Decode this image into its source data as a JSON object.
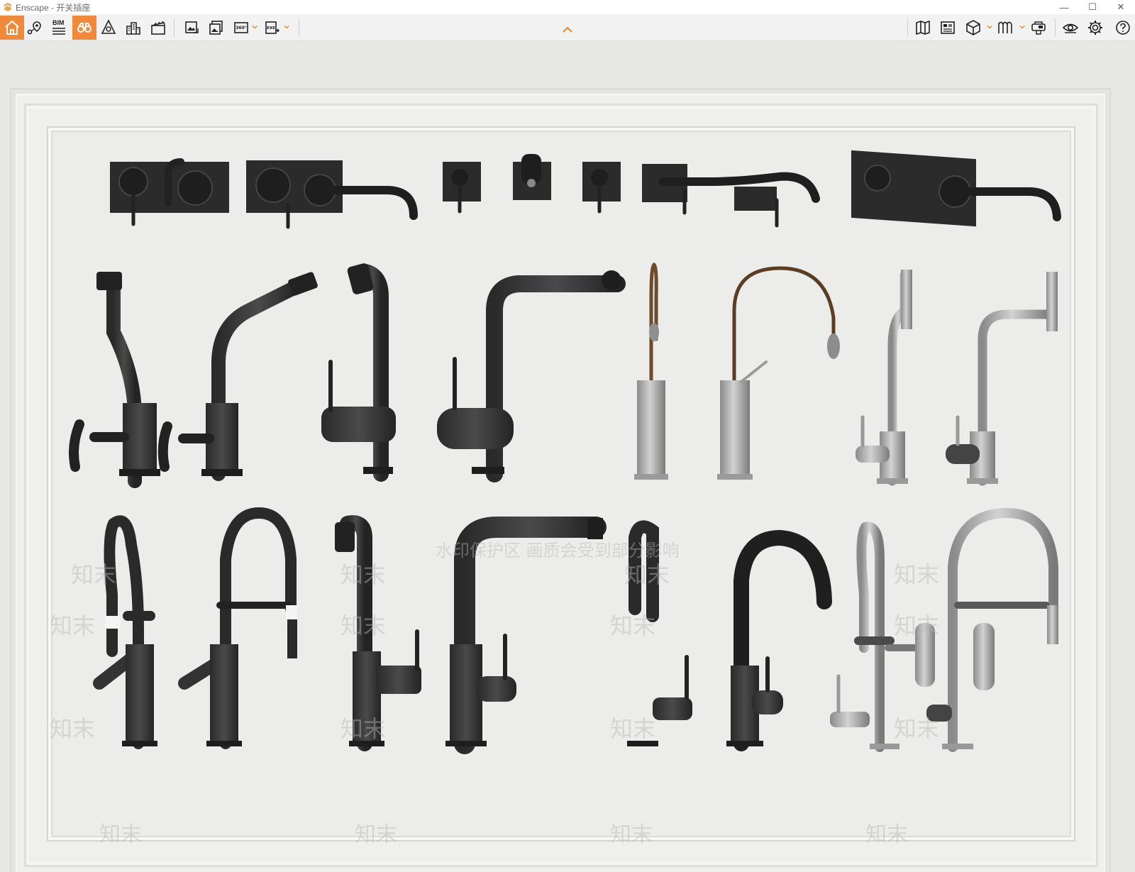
{
  "window": {
    "title": "Enscape - 开关插座",
    "minimize": "—",
    "maximize": "☐",
    "close": "✕"
  },
  "toolbar": {
    "left_buttons": [
      {
        "name": "home-icon",
        "active": true
      },
      {
        "name": "location-pin-icon",
        "active": false
      },
      {
        "name": "bim-icon",
        "label": "BIM",
        "active": false
      },
      {
        "name": "binoculars-icon",
        "active": true
      },
      {
        "name": "perspective-icon",
        "active": false
      },
      {
        "name": "buildings-icon",
        "active": false
      },
      {
        "name": "clapperboard-icon",
        "active": false
      },
      {
        "name": "export-image-icon",
        "active": false
      },
      {
        "name": "batch-export-icon",
        "active": false
      },
      {
        "name": "panorama-360-icon",
        "label": "360°",
        "active": false
      },
      {
        "name": "export-exe-icon",
        "label": "EXE",
        "active": false
      }
    ],
    "right_buttons": [
      {
        "name": "map-icon"
      },
      {
        "name": "asset-library-icon"
      },
      {
        "name": "cube-view-icon"
      },
      {
        "name": "material-icon"
      },
      {
        "name": "vr-headset-icon"
      },
      {
        "name": "eye-icon"
      },
      {
        "name": "settings-gear-icon"
      },
      {
        "name": "help-icon"
      }
    ],
    "accent_color": "#f08a3a"
  },
  "viewport": {
    "watermark_text": "水印保护区  画质会受到部分影响",
    "watermark_repeat": "知末"
  }
}
